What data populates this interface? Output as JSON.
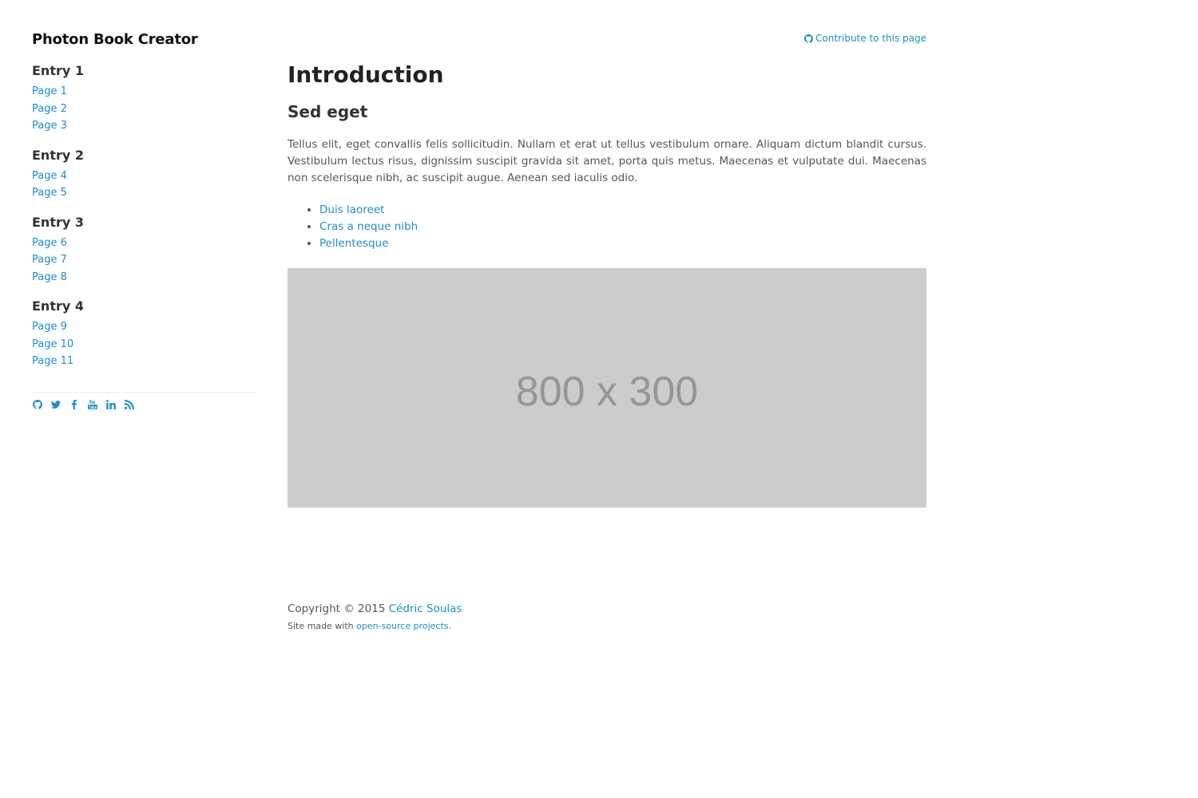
{
  "site": {
    "title": "Photon Book Creator"
  },
  "sidebar": {
    "entries": [
      {
        "title": "Entry 1",
        "pages": [
          "Page 1",
          "Page 2",
          "Page 3"
        ]
      },
      {
        "title": "Entry 2",
        "pages": [
          "Page 4",
          "Page 5"
        ]
      },
      {
        "title": "Entry 3",
        "pages": [
          "Page 6",
          "Page 7",
          "Page 8"
        ]
      },
      {
        "title": "Entry 4",
        "pages": [
          "Page 9",
          "Page 10",
          "Page 11"
        ]
      }
    ],
    "social_icons": [
      "github-icon",
      "twitter-icon",
      "facebook-icon",
      "youtube-icon",
      "linkedin-icon",
      "rss-icon"
    ]
  },
  "main": {
    "contribute_label": "Contribute to this page",
    "title": "Introduction",
    "section_title": "Sed eget",
    "paragraph": "Tellus elit, eget convallis felis sollicitudin. Nullam et erat ut tellus vestibulum ornare. Aliquam dictum blandit cursus. Vestibulum lectus risus, dignissim suscipit gravida sit amet, porta quis metus. Maecenas et vulputate dui. Maecenas non scelerisque nibh, ac suscipit augue. Aenean sed iaculis odio.",
    "list_items": [
      "Duis laoreet",
      "Cras a neque nibh",
      "Pellentesque"
    ],
    "image_placeholder": "800 x 300"
  },
  "footer": {
    "copyright_prefix": "Copyright © 2015 ",
    "author": "Cédric Soulas",
    "made_with_prefix": "Site made with ",
    "made_with_link": "open-source projects."
  },
  "colors": {
    "link": "#1a8fc9",
    "placeholder_bg": "#cccccc",
    "placeholder_text": "#969696"
  }
}
